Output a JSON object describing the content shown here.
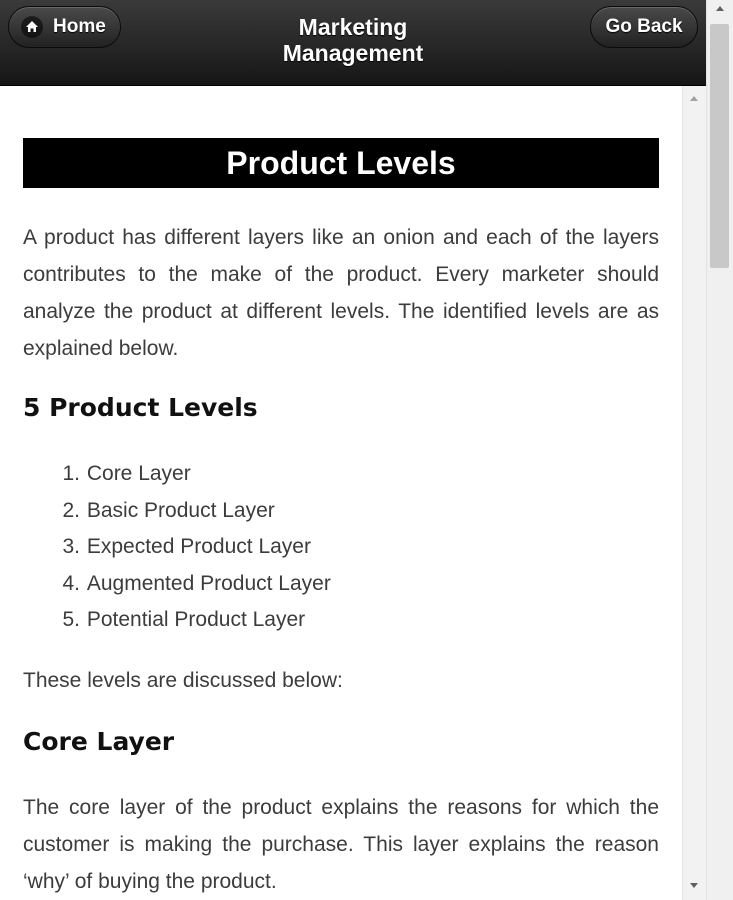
{
  "header": {
    "title_line1": "Marketing",
    "title_line2": "Management",
    "home_label": "Home",
    "home_icon": "home-icon",
    "back_label": "Go Back"
  },
  "article": {
    "title": "Product Levels",
    "intro": "A product has different layers like an onion and each of the layers contributes to the make of the product. Every marketer should analyze the product at different levels. The identified levels are as explained below.",
    "levels_heading": "5 Product Levels",
    "levels": [
      {
        "num": "1.",
        "label": "Core Layer"
      },
      {
        "num": "2.",
        "label": "Basic Product Layer"
      },
      {
        "num": "3.",
        "label": "Expected Product Layer"
      },
      {
        "num": "4.",
        "label": "Augmented Product Layer"
      },
      {
        "num": "5.",
        "label": "Potential Product Layer"
      }
    ],
    "discussed": "These levels are discussed below:",
    "core_heading": "Core Layer",
    "core_text": "The core layer of the product explains the reasons for which the customer is making the purchase. This layer explains the reason ‘why’ of buying the product."
  },
  "colors": {
    "header_bg": "#1e1e1e",
    "title_bar_bg": "#000000",
    "body_text": "#3c3c3c",
    "heading_text": "#111111"
  }
}
